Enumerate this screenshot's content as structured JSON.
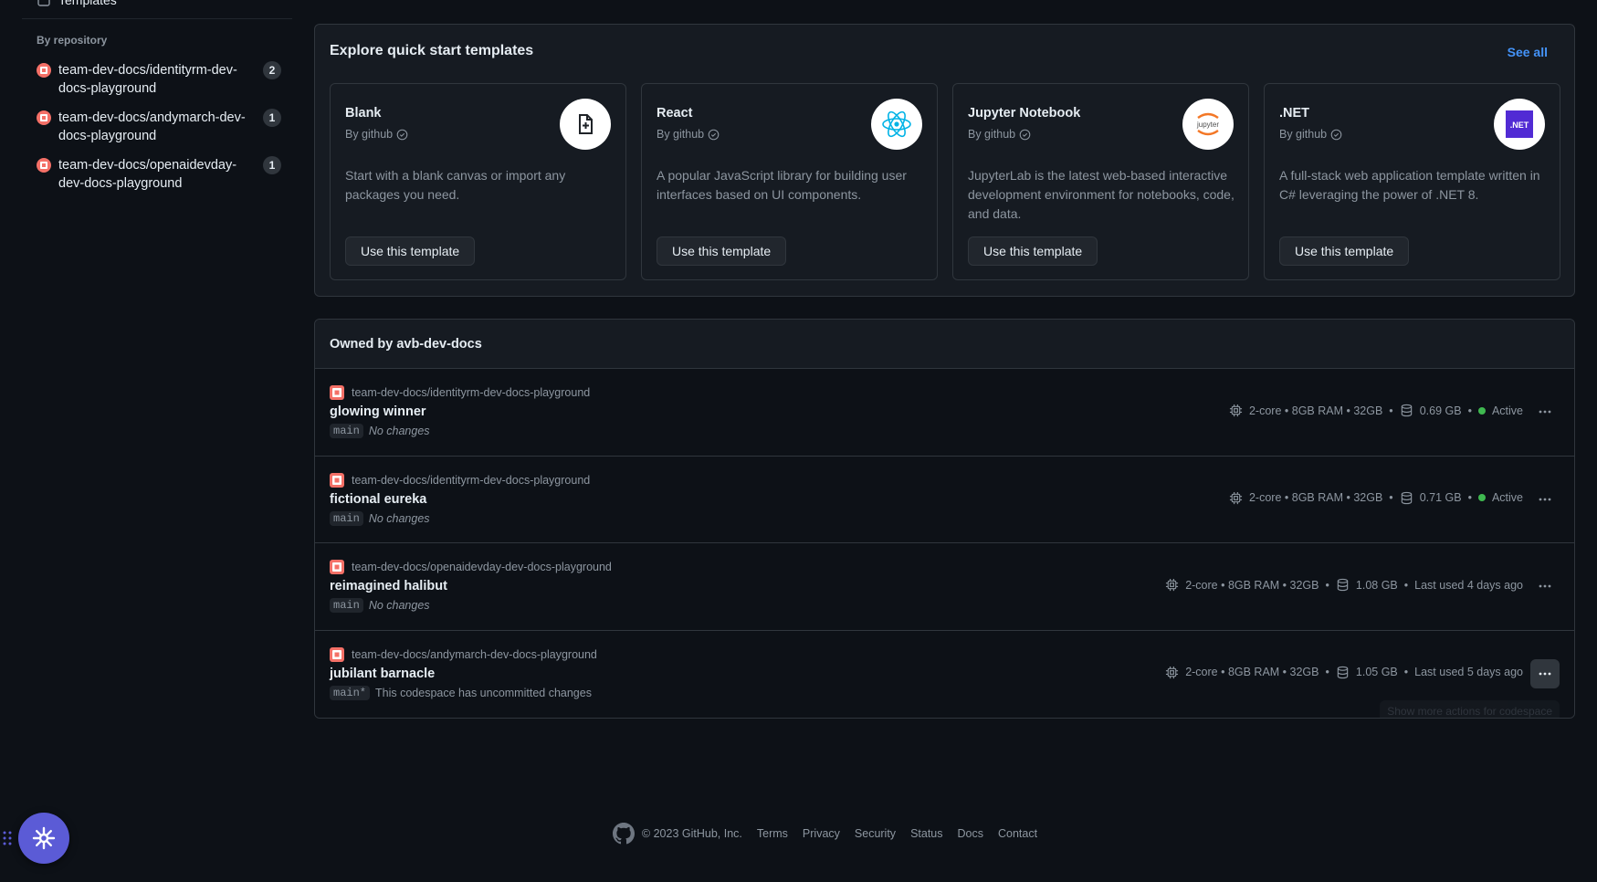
{
  "sidebar": {
    "top_item_label": "Templates",
    "heading": "By repository",
    "repos": [
      {
        "name": "team-dev-docs/identityrm-dev-docs-playground",
        "count": "2"
      },
      {
        "name": "team-dev-docs/andymarch-dev-docs-playground",
        "count": "1"
      },
      {
        "name": "team-dev-docs/openaidevday-dev-docs-playground",
        "count": "1"
      }
    ]
  },
  "templates": {
    "title": "Explore quick start templates",
    "see_all": "See all",
    "cards": [
      {
        "name": "Blank",
        "by": "By github",
        "desc": "Start with a blank canvas or import any packages you need.",
        "button": "Use this template",
        "icon": "file-add-icon"
      },
      {
        "name": "React",
        "by": "By github",
        "desc": "A popular JavaScript library for building user interfaces based on UI components.",
        "button": "Use this template",
        "icon": "react-icon"
      },
      {
        "name": "Jupyter Notebook",
        "by": "By github",
        "desc": "JupyterLab is the latest web-based interactive development environment for notebooks, code, and data.",
        "button": "Use this template",
        "icon": "jupyter-icon",
        "logo_text": "jupyter"
      },
      {
        "name": ".NET",
        "by": "By github",
        "desc": "A full-stack web application template written in C# leveraging the power of .NET 8.",
        "button": "Use this template",
        "icon": "dotnet-icon",
        "logo_text": ".NET"
      }
    ]
  },
  "owned": {
    "title": "Owned by avb-dev-docs",
    "codespaces": [
      {
        "repo": "team-dev-docs/identityrm-dev-docs-playground",
        "name": "glowing winner",
        "branch": "main",
        "changes": "No changes",
        "machine": "2-core • 8GB RAM • 32GB",
        "storage": "0.69 GB",
        "status": "Active"
      },
      {
        "repo": "team-dev-docs/identityrm-dev-docs-playground",
        "name": "fictional eureka",
        "branch": "main",
        "changes": "No changes",
        "machine": "2-core • 8GB RAM • 32GB",
        "storage": "0.71 GB",
        "status": "Active"
      },
      {
        "repo": "team-dev-docs/openaidevday-dev-docs-playground",
        "name": "reimagined halibut",
        "branch": "main",
        "changes": "No changes",
        "machine": "2-core • 8GB RAM • 32GB",
        "storage": "1.08 GB",
        "status": "Last used 4 days ago"
      },
      {
        "repo": "team-dev-docs/andymarch-dev-docs-playground",
        "name": "jubilant barnacle",
        "branch": "main*",
        "changes": "This codespace has uncommitted changes",
        "machine": "2-core • 8GB RAM • 32GB",
        "storage": "1.05 GB",
        "status": "Last used 5 days ago"
      }
    ],
    "tooltip": "Show more actions for codespace"
  },
  "footer": {
    "copyright": "© 2023 GitHub, Inc.",
    "links": [
      "Terms",
      "Privacy",
      "Security",
      "Status",
      "Docs",
      "Contact"
    ]
  },
  "colors": {
    "background": "#0d1117",
    "panel": "#161b22",
    "border": "#30363d",
    "link": "#4493f8",
    "active": "#3fb950",
    "launcher": "#5b5bd6"
  }
}
